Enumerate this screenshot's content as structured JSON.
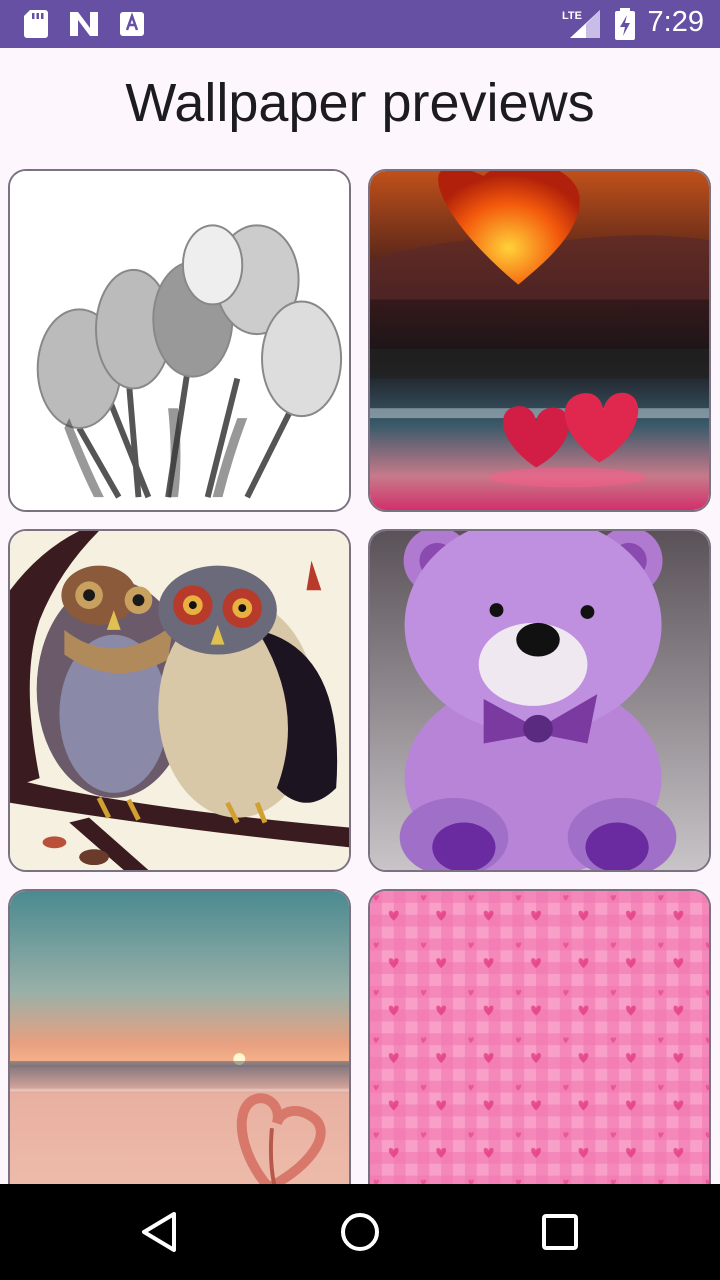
{
  "status_bar": {
    "time": "7:29",
    "network_label": "LTE",
    "icons": [
      "sd-card-icon",
      "n-notification-icon",
      "a-notification-icon",
      "signal-icon",
      "battery-charging-icon"
    ]
  },
  "header": {
    "title": "Wallpaper previews"
  },
  "wallpapers": [
    {
      "subject": "tulips-grayscale"
    },
    {
      "subject": "hearts-sunset"
    },
    {
      "subject": "owls-on-branch"
    },
    {
      "subject": "purple-teddy-bear"
    },
    {
      "subject": "flamingo-heart-sunset"
    },
    {
      "subject": "pink-gingham-hearts"
    }
  ],
  "nav_bar": {
    "icons": [
      "back-icon",
      "home-icon",
      "recents-icon"
    ]
  },
  "colors": {
    "status_bar": "#6650a4",
    "background": "#fdf7fd",
    "card_border": "#7a7282",
    "nav_bar": "#000000"
  }
}
